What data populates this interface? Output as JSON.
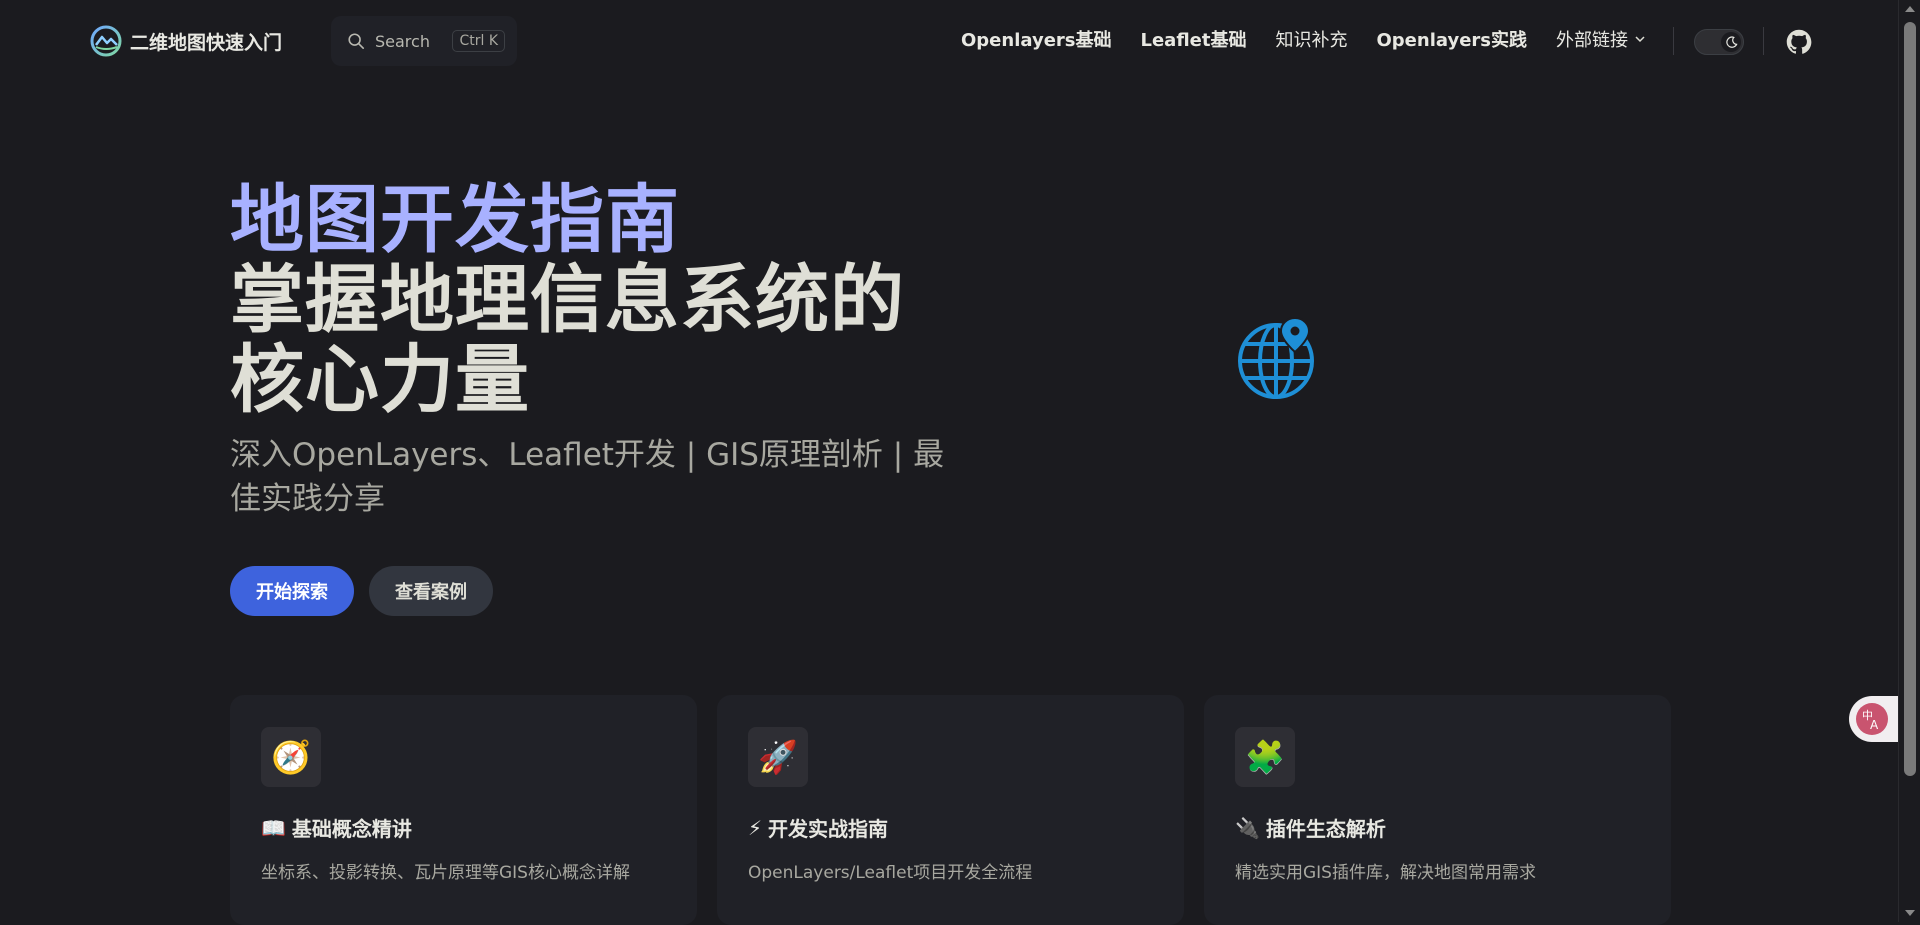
{
  "nav": {
    "brand_title": "二维地图快速入门",
    "search": {
      "placeholder": "Search",
      "shortcut": "Ctrl K"
    },
    "links": [
      {
        "label": "Openlayers基础"
      },
      {
        "label": "Leaflet基础"
      },
      {
        "label": "知识补充"
      },
      {
        "label": "Openlayers实践"
      },
      {
        "label": "外部链接"
      }
    ]
  },
  "hero": {
    "name": "地图开发指南",
    "text": "掌握地理信息系统的核心力量",
    "tagline": "深入OpenLayers、Leaflet开发 | GIS原理剖析 | 最佳实践分享",
    "actions": [
      {
        "label": "开始探索",
        "theme": "brand"
      },
      {
        "label": "查看案例",
        "theme": "alt"
      }
    ]
  },
  "features": [
    {
      "icon": "🧭",
      "title_icon": "📖",
      "title": "基础概念精讲",
      "details": "坐标系、投影转换、瓦片原理等GIS核心概念详解"
    },
    {
      "icon": "🚀",
      "title_icon": "⚡",
      "title": "开发实战指南",
      "details": "OpenLayers/Leaflet项目开发全流程"
    },
    {
      "icon": "🧩",
      "title_icon": "🔌",
      "title": "插件生态解析",
      "details": "精选实用GIS插件库，解决地图常用需求"
    }
  ],
  "colors": {
    "background": "#1b1b1f",
    "brand": "#3e63dd",
    "hero_name": "#a8b1ff",
    "card": "#202127"
  },
  "icons": {
    "brand_logo": "mountain-wave-logo",
    "search": "search-icon",
    "dropdown": "chevron-down-icon",
    "theme": "moon-icon",
    "github": "github-icon",
    "hero_image": "globe-pin-icon",
    "translate": "translate-icon"
  }
}
